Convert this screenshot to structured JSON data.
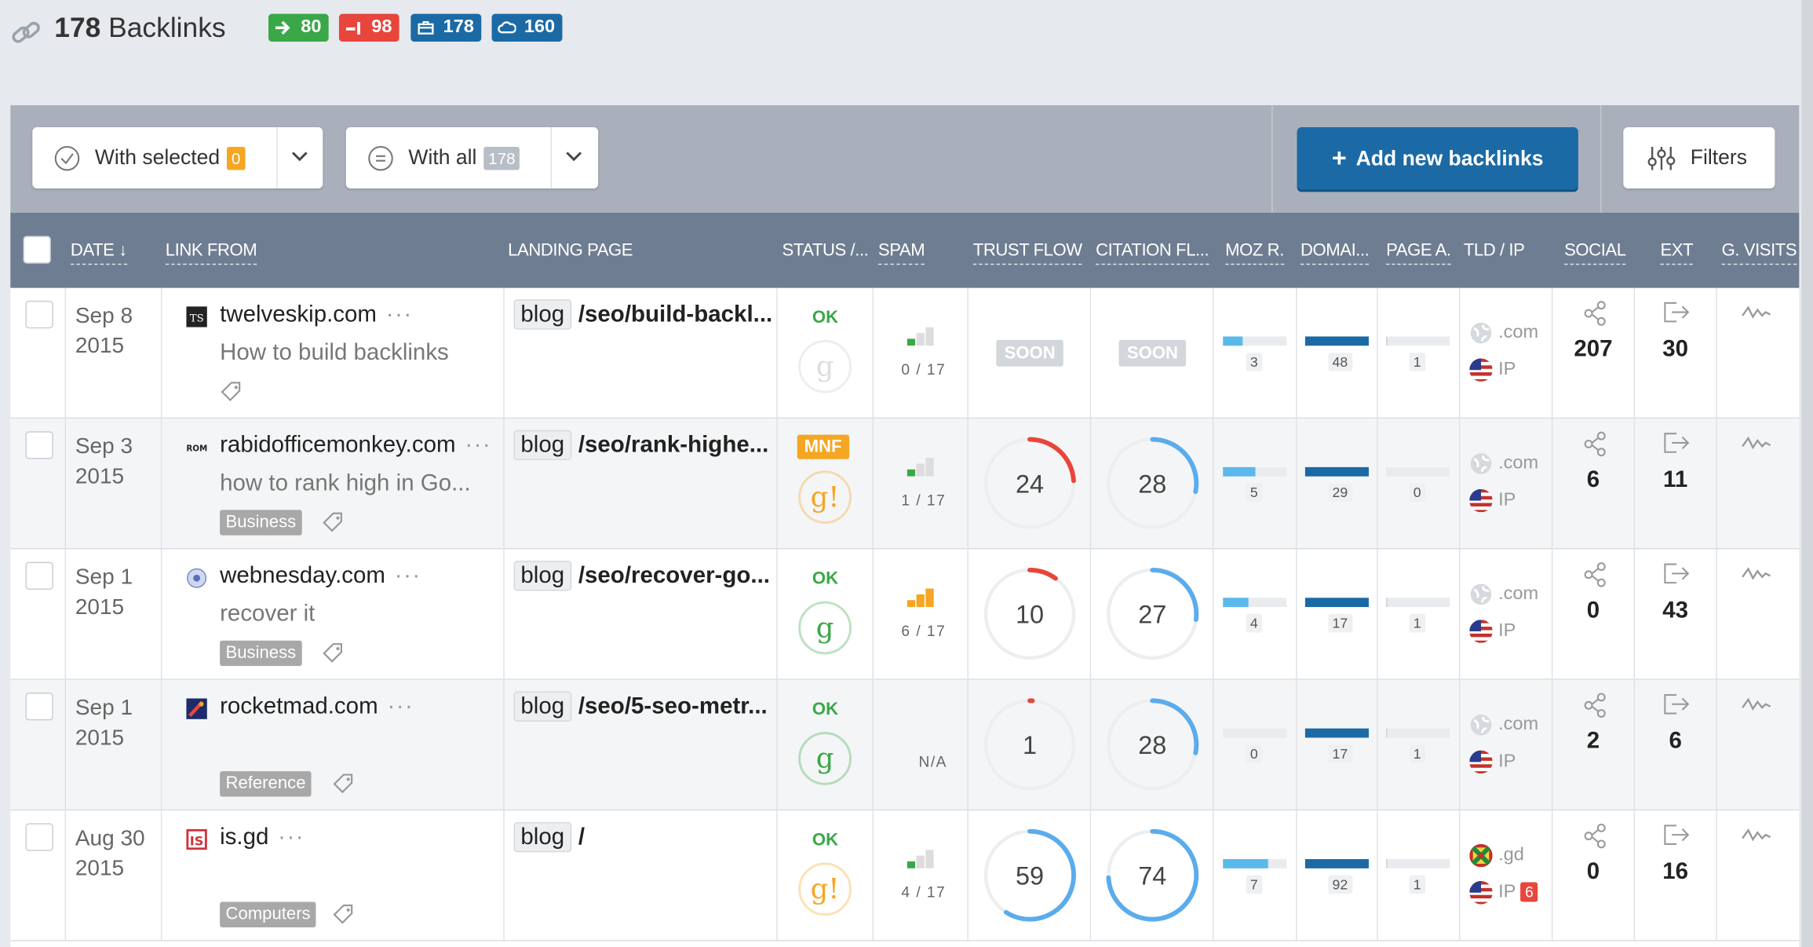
{
  "header": {
    "count": "178",
    "title": "Backlinks",
    "badges": [
      {
        "name": "new-links-badge",
        "value": "80",
        "color": "#3aa848"
      },
      {
        "name": "lost-links-badge",
        "value": "98",
        "color": "#e8453c"
      },
      {
        "name": "domains-badge",
        "value": "178",
        "color": "#1b6aa5"
      },
      {
        "name": "ips-badge",
        "value": "160",
        "color": "#1b6aa5"
      }
    ]
  },
  "toolbar": {
    "with_selected": "With selected",
    "selected_count": "0",
    "with_all": "With all",
    "all_count": "178",
    "add": "Add new backlinks",
    "filters": "Filters"
  },
  "columns": [
    "DATE",
    "LINK FROM",
    "LANDING PAGE",
    "STATUS /...",
    "SPAM",
    "TRUST FLOW",
    "CITATION FL...",
    "MOZ R.",
    "DOMAI...",
    "PAGE A.",
    "TLD / IP",
    "SOCIAL",
    "EXT",
    "G. VISITS"
  ],
  "rows": [
    {
      "date": "Sep 8",
      "year": "2015",
      "site": "twelveskip.com",
      "dots": "···",
      "anchor": "How to build backlinks",
      "tag": "",
      "blog": "blog",
      "path": "/seo/build-backl...",
      "status": "OK",
      "status_color": "#3aa848",
      "g": "g",
      "g_color": "#ddd",
      "spam": "0 / 17",
      "trust": "SOON",
      "citation": "SOON",
      "moz": "3",
      "moz_pct": 0.3,
      "dom": "48",
      "dom_pct": 1,
      "page": "1",
      "page_pct": 0.02,
      "tld": ".com",
      "ip": "IP",
      "ip_count": "",
      "social": "207",
      "ext": "30"
    },
    {
      "date": "Sep 3",
      "year": "2015",
      "site": "rabidofficemonkey.com",
      "dots": "···",
      "anchor": "how to rank high in Go...",
      "tag": "Business",
      "blog": "blog",
      "path": "/seo/rank-highe...",
      "status": "MNF",
      "status_color": "#f5a623",
      "g": "g!",
      "g_color": "#f5a623",
      "spam": "1 / 17",
      "trust": "24",
      "trust_pct": 0.24,
      "trust_color": "#e8453c",
      "citation": "28",
      "cit_pct": 0.28,
      "moz": "5",
      "moz_pct": 0.5,
      "dom": "29",
      "dom_pct": 1,
      "page": "0",
      "page_pct": 0,
      "tld": ".com",
      "ip": "IP",
      "ip_count": "",
      "social": "6",
      "ext": "11"
    },
    {
      "date": "Sep 1",
      "year": "2015",
      "site": "webnesday.com",
      "dots": "···",
      "anchor": "recover it",
      "tag": "Business",
      "blog": "blog",
      "path": "/seo/recover-go...",
      "status": "OK",
      "status_color": "#3aa848",
      "g": "g",
      "g_color": "#3aa848",
      "spam": "6 / 17",
      "trust": "10",
      "trust_pct": 0.1,
      "trust_color": "#e8453c",
      "citation": "27",
      "cit_pct": 0.27,
      "moz": "4",
      "moz_pct": 0.4,
      "dom": "17",
      "dom_pct": 1,
      "page": "1",
      "page_pct": 0.02,
      "tld": ".com",
      "ip": "IP",
      "ip_count": "",
      "social": "0",
      "ext": "43"
    },
    {
      "date": "Sep 1",
      "year": "2015",
      "site": "rocketmad.com",
      "dots": "···",
      "anchor": "",
      "tag": "Reference",
      "blog": "blog",
      "path": "/seo/5-seo-metr...",
      "status": "OK",
      "status_color": "#3aa848",
      "g": "g",
      "g_color": "#3aa848",
      "spam": "N/A",
      "trust": "1",
      "trust_pct": 0.01,
      "trust_color": "#e8453c",
      "citation": "28",
      "cit_pct": 0.28,
      "moz": "0",
      "moz_pct": 0,
      "dom": "17",
      "dom_pct": 1,
      "page": "1",
      "page_pct": 0.02,
      "tld": ".com",
      "ip": "IP",
      "ip_count": "",
      "social": "2",
      "ext": "6"
    },
    {
      "date": "Aug 30",
      "year": "2015",
      "site": "is.gd",
      "dots": "···",
      "anchor": "",
      "tag": "Computers",
      "blog": "blog",
      "path": "/",
      "status": "OK",
      "status_color": "#3aa848",
      "g": "g!",
      "g_color": "#f5a623",
      "spam": "4 / 17",
      "trust": "59",
      "trust_pct": 0.59,
      "trust_color": "#5aacec",
      "citation": "74",
      "cit_pct": 0.74,
      "moz": "7",
      "moz_pct": 0.7,
      "dom": "92",
      "dom_pct": 1,
      "page": "1",
      "page_pct": 0.02,
      "tld": ".gd",
      "ip": "IP",
      "ip_count": "6",
      "social": "0",
      "ext": "16"
    }
  ]
}
